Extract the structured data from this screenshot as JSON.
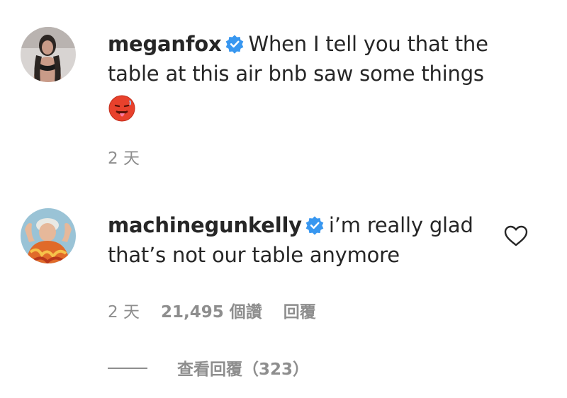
{
  "comments": [
    {
      "username": "meganfox",
      "text": "When I tell you that the table at this air bnb saw some things",
      "emoji": "🥵",
      "time": "2 天"
    },
    {
      "username": "machinegunkelly",
      "text": "i’m really glad that’s not our table anymore",
      "time": "2 天",
      "likes": "21,495 個讚",
      "reply_label": "回覆"
    }
  ],
  "view_replies": "查看回覆（323）",
  "colors": {
    "text": "#262626",
    "meta": "#8e8e8e",
    "verified_badge": "#3897f0"
  }
}
